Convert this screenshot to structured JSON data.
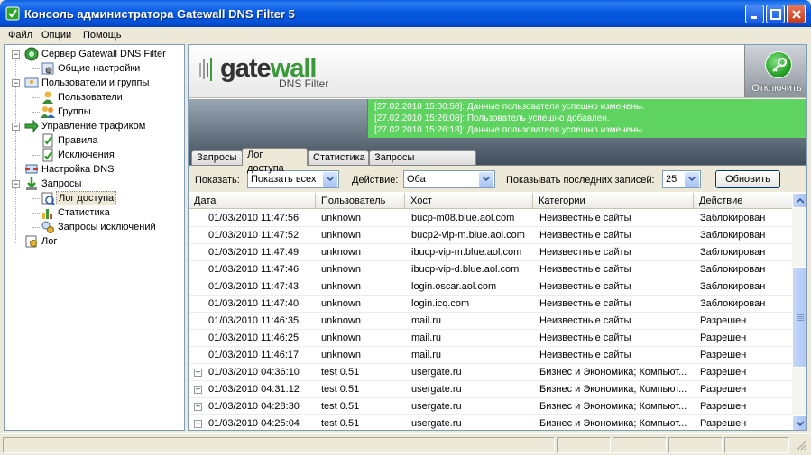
{
  "window": {
    "title": "Консоль администратора Gatewall DNS Filter 5"
  },
  "menu": [
    "Файл",
    "Опции",
    "Помощь"
  ],
  "tree": {
    "root": "Сервер Gatewall DNS Filter",
    "general_settings": "Общие настройки",
    "users_groups": "Пользователи и группы",
    "users": "Пользователи",
    "groups": "Группы",
    "traffic": "Управление трафиком",
    "rules": "Правила",
    "exceptions": "Исключения",
    "dns_settings": "Настройка DNS",
    "queries": "Запросы",
    "access_log": "Лог доступа",
    "statistics": "Статистика",
    "exception_queries": "Запросы исключений",
    "log": "Лог"
  },
  "header": {
    "logo_gate": "gate",
    "logo_wall": "wall",
    "logo_sub": "DNS Filter",
    "disconnect_label": "Отключить"
  },
  "status_messages": [
    "[27.02.2010 15:00:58]: Данные пользователя успешно изменены.",
    "[27.02.2010 15:26:08]: Пользователь успешно добавлен.",
    "[27.02.2010 15:26:18]: Данные пользователя успешно изменены."
  ],
  "tabs": [
    "Запросы",
    "Лог доступа",
    "Статистика",
    "Запросы исключений"
  ],
  "filters": {
    "show_label": "Показать:",
    "show_value": "Показать всех",
    "action_label": "Действие:",
    "action_value": "Оба",
    "last_label": "Показывать последних записей:",
    "last_value": "25",
    "refresh_label": "Обновить"
  },
  "table": {
    "columns": [
      "Дата",
      "Пользователь",
      "Хост",
      "Категории",
      "Действие"
    ],
    "rows": [
      {
        "expand": false,
        "date": "01/03/2010 11:47:56",
        "user": "unknown",
        "host": "bucp-m08.blue.aol.com",
        "category": "Неизвестные сайты",
        "action": "Заблокирован"
      },
      {
        "expand": false,
        "date": "01/03/2010 11:47:52",
        "user": "unknown",
        "host": "bucp2-vip-m.blue.aol.com",
        "category": "Неизвестные сайты",
        "action": "Заблокирован"
      },
      {
        "expand": false,
        "date": "01/03/2010 11:47:49",
        "user": "unknown",
        "host": "ibucp-vip-m.blue.aol.com",
        "category": "Неизвестные сайты",
        "action": "Заблокирован"
      },
      {
        "expand": false,
        "date": "01/03/2010 11:47:46",
        "user": "unknown",
        "host": "ibucp-vip-d.blue.aol.com",
        "category": "Неизвестные сайты",
        "action": "Заблокирован"
      },
      {
        "expand": false,
        "date": "01/03/2010 11:47:43",
        "user": "unknown",
        "host": "login.oscar.aol.com",
        "category": "Неизвестные сайты",
        "action": "Заблокирован"
      },
      {
        "expand": false,
        "date": "01/03/2010 11:47:40",
        "user": "unknown",
        "host": "login.icq.com",
        "category": "Неизвестные сайты",
        "action": "Заблокирован"
      },
      {
        "expand": false,
        "date": "01/03/2010 11:46:35",
        "user": "unknown",
        "host": "mail.ru",
        "category": "Неизвестные сайты",
        "action": "Разрешен"
      },
      {
        "expand": false,
        "date": "01/03/2010 11:46:25",
        "user": "unknown",
        "host": "mail.ru",
        "category": "Неизвестные сайты",
        "action": "Разрешен"
      },
      {
        "expand": false,
        "date": "01/03/2010 11:46:17",
        "user": "unknown",
        "host": "mail.ru",
        "category": "Неизвестные сайты",
        "action": "Разрешен"
      },
      {
        "expand": true,
        "date": "01/03/2010 04:36:10",
        "user": "test 0.51",
        "host": "usergate.ru",
        "category": "Бизнес и Экономика; Компьют...",
        "action": "Разрешен"
      },
      {
        "expand": true,
        "date": "01/03/2010 04:31:12",
        "user": "test 0.51",
        "host": "usergate.ru",
        "category": "Бизнес и Экономика; Компьют...",
        "action": "Разрешен"
      },
      {
        "expand": true,
        "date": "01/03/2010 04:28:30",
        "user": "test 0.51",
        "host": "usergate.ru",
        "category": "Бизнес и Экономика; Компьют...",
        "action": "Разрешен"
      },
      {
        "expand": true,
        "date": "01/03/2010 04:25:04",
        "user": "test 0.51",
        "host": "usergate.ru",
        "category": "Бизнес и Экономика; Компьют...",
        "action": "Разрешен"
      }
    ]
  },
  "colors": {
    "titlebar": "#0758e0",
    "status_green": "#5fd35f",
    "logo_green": "#3a9a3a"
  }
}
